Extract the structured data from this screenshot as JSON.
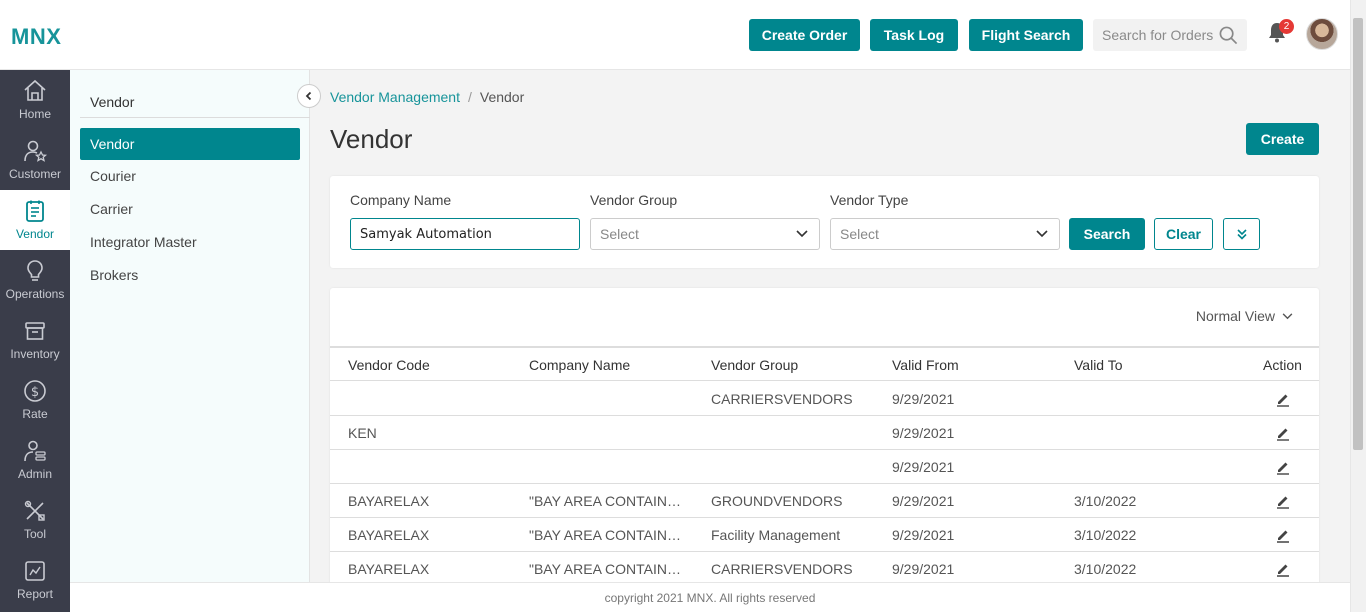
{
  "app": {
    "logo": "MNX"
  },
  "topbar": {
    "create_order": "Create Order",
    "task_log": "Task Log",
    "flight_search": "Flight Search",
    "search_placeholder": "Search for Orders",
    "notification_count": "2"
  },
  "nav": {
    "items": [
      {
        "label": "Home",
        "icon": "home-icon"
      },
      {
        "label": "Customer",
        "icon": "customer-icon"
      },
      {
        "label": "Vendor",
        "icon": "vendor-icon",
        "active": true
      },
      {
        "label": "Operations",
        "icon": "bulb-icon"
      },
      {
        "label": "Inventory",
        "icon": "box-icon"
      },
      {
        "label": "Rate",
        "icon": "dollar-icon"
      },
      {
        "label": "Admin",
        "icon": "admin-icon"
      },
      {
        "label": "Tool",
        "icon": "tools-icon"
      },
      {
        "label": "Report",
        "icon": "report-icon"
      }
    ]
  },
  "subnav": {
    "title": "Vendor",
    "items": [
      {
        "label": "Vendor",
        "active": true
      },
      {
        "label": "Courier"
      },
      {
        "label": "Carrier"
      },
      {
        "label": "Integrator Master"
      },
      {
        "label": "Brokers"
      }
    ]
  },
  "breadcrumb": {
    "parent": "Vendor Management",
    "separator": "/",
    "current": "Vendor"
  },
  "page": {
    "title": "Vendor",
    "create": "Create"
  },
  "filters": {
    "company_name_label": "Company Name",
    "company_name_value": "Samyak Automation",
    "vendor_group_label": "Vendor Group",
    "vendor_group_value": "Select",
    "vendor_type_label": "Vendor Type",
    "vendor_type_value": "Select",
    "search": "Search",
    "clear": "Clear"
  },
  "table": {
    "view": "Normal View",
    "columns": [
      "Vendor Code",
      "Company Name",
      "Vendor Group",
      "Valid From",
      "Valid To",
      "Action"
    ],
    "rows": [
      [
        "",
        "",
        "CARRIERSVENDORS",
        "9/29/2021",
        ""
      ],
      [
        "KEN",
        "",
        "",
        "9/29/2021",
        ""
      ],
      [
        "",
        "",
        "",
        "9/29/2021",
        ""
      ],
      [
        "BAYARELAX",
        "\"BAY AREA CONTAINER...",
        "GROUNDVENDORS",
        "9/29/2021",
        "3/10/2022"
      ],
      [
        "BAYARELAX",
        "\"BAY AREA CONTAINER...",
        "Facility Management",
        "9/29/2021",
        "3/10/2022"
      ],
      [
        "BAYARELAX",
        "\"BAY AREA CONTAINER...",
        "CARRIERSVENDORS",
        "9/29/2021",
        "3/10/2022"
      ]
    ]
  },
  "footer": {
    "copyright": "copyright 2021 MNX. All rights reserved"
  },
  "colors": {
    "brand": "#00868e",
    "nav_bg": "#3a3d4a",
    "badge": "#e53935"
  }
}
